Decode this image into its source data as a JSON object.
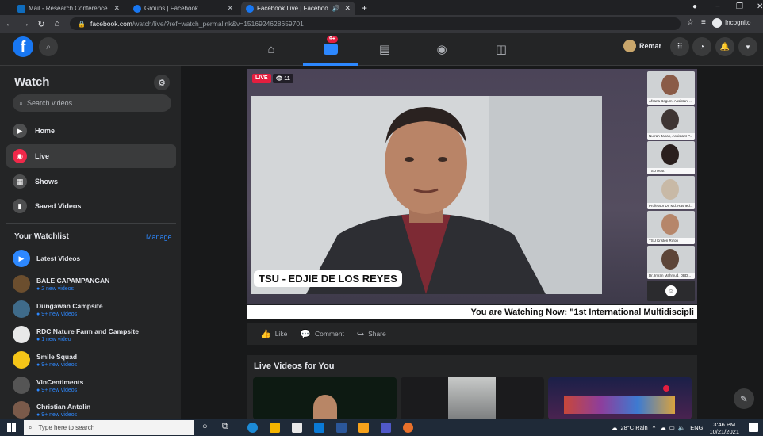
{
  "browser": {
    "tabs": [
      {
        "title": "Mail - Research Conference - Ou",
        "favicon_color": "#0f6cbd"
      },
      {
        "title": "Groups | Facebook",
        "favicon_color": "#1877f2"
      },
      {
        "title": "Facebook Live | Facebook",
        "favicon_color": "#1877f2"
      }
    ],
    "url_domain": "facebook.com",
    "url_path": "/watch/live/?ref=watch_permalink&v=1516924628659701",
    "incognito_label": "Incognito"
  },
  "header": {
    "profile_name": "Remar",
    "video_badge": "9+"
  },
  "sidebar": {
    "title": "Watch",
    "search_placeholder": "Search videos",
    "nav": [
      {
        "label": "Home"
      },
      {
        "label": "Live"
      },
      {
        "label": "Shows"
      },
      {
        "label": "Saved Videos"
      }
    ],
    "watchlist_title": "Your Watchlist",
    "manage_label": "Manage",
    "watchlist": [
      {
        "name": "Latest Videos",
        "sub": "",
        "color": "#2d88ff"
      },
      {
        "name": "BALE CAPAMPANGAN",
        "sub": "2 new videos",
        "color": "#6b4e2e"
      },
      {
        "name": "Dungawan Campsite",
        "sub": "9+ new videos",
        "color": "#3f6b8a"
      },
      {
        "name": "RDC Nature Farm and Campsite",
        "sub": "1 new video",
        "color": "#e8e8e8"
      },
      {
        "name": "Smile Squad",
        "sub": "9+ new videos",
        "color": "#f5c518"
      },
      {
        "name": "VinCentiments",
        "sub": "9+ new videos",
        "color": "#2b2b2b"
      },
      {
        "name": "Christian Antolin",
        "sub": "9+ new videos",
        "color": "#7a5a4a"
      }
    ]
  },
  "video": {
    "live_label": "LIVE",
    "viewers": "11",
    "lower_third": "TSU - EDJIE DE LOS REYES",
    "ticker": "You are Watching Now: \"1st International Multidiscipli",
    "participants": [
      "Afsana Begum, Assistant ...",
      "Nurrah Jahan, Assistant P...",
      "TSU Host",
      "Professor Dr. Md. Rashed...",
      "TSU Kristen Rizon",
      "Dr. Imran Mahmud, DBD..."
    ]
  },
  "actions": {
    "like": "Like",
    "comment": "Comment",
    "share": "Share"
  },
  "live_section": {
    "title": "Live Videos for You"
  },
  "taskbar": {
    "search_placeholder": "Type here to search",
    "weather": "28°C  Rain",
    "lang": "ENG",
    "time": "3:46 PM",
    "date": "10/21/2021"
  }
}
